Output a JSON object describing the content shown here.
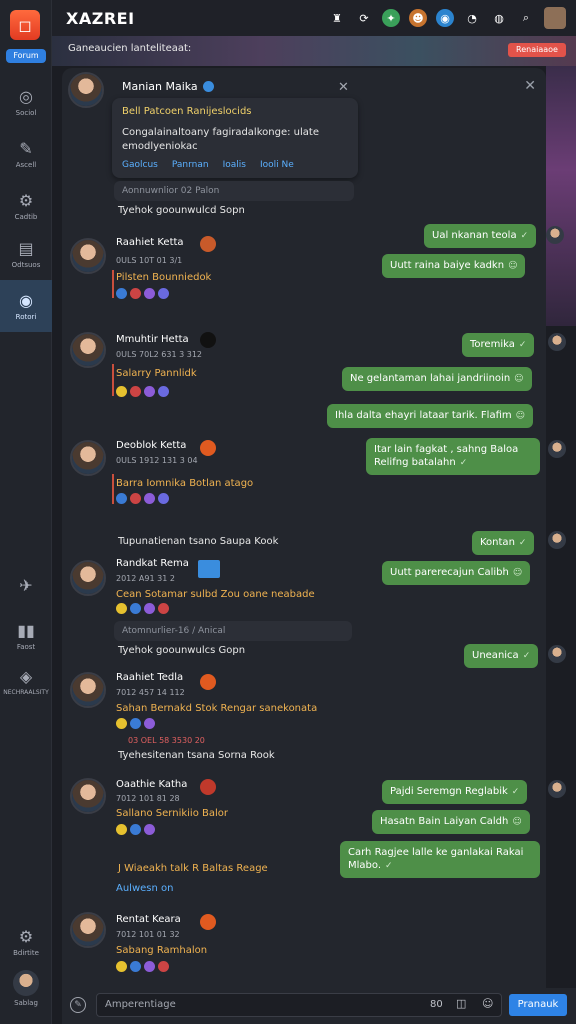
{
  "app": {
    "brand": "XAZREI",
    "logo_pill": "Forum",
    "banner_text": "Ganeaucien lanteliteaat:",
    "banner_button": "Renaiaaoe"
  },
  "rail": {
    "items": [
      {
        "label": "Sociol",
        "icon": "◎"
      },
      {
        "label": "Ascell",
        "icon": "✎"
      },
      {
        "label": "Cadtib",
        "icon": "⚙"
      },
      {
        "label": "Odtsuos",
        "icon": "▤"
      },
      {
        "label": "Rotori",
        "icon": "◉"
      }
    ],
    "bottom_items": [
      {
        "label": "",
        "icon": "✈"
      },
      {
        "label": "Faost",
        "icon": "▮▮"
      },
      {
        "label": "NECHRAALSITY",
        "icon": "◈"
      },
      {
        "label": "Bdirtite",
        "icon": "⚙"
      },
      {
        "label": "Sablag",
        "icon": ""
      }
    ]
  },
  "header": {
    "name": "Manian Maika",
    "popup_line1": "Bell Patcoen Ranijeslocids",
    "popup_line2": "Congalainaltoany fagiradalkonge: ulate emodlyeniokac",
    "popup_links": [
      "Gaolcus",
      "Panrnan",
      "Ioalis",
      "Iooli Ne"
    ]
  },
  "search1": "Aonnuwnlior 02 Palon",
  "search2": "Atomnurlier-16 / Anical",
  "system": [
    "Tyehok goounwulcd Sopn",
    "Tupunatienan tsano Saupa Kook",
    "Tyehok goounwulcs Gopn",
    "Tyehesitenan tsana Sorna Rook",
    "J Wiaeakh talk R Baltas Reage",
    "Aulwesn on"
  ],
  "messages": [
    {
      "name": "Raahiet Ketta",
      "meta": "0ULS  10T 01 3/1",
      "text": "Pilsten Bounniedok"
    },
    {
      "name": "Mmuhtir Hetta",
      "meta": "0ULS  70L2  631 3 312",
      "text": "Salarry Pannlidk"
    },
    {
      "name": "Deoblok Ketta",
      "meta": "0ULS  1912 131 3 04",
      "text": "Barra Iomnika Botlan atago"
    },
    {
      "name": "Randkat Rema",
      "meta": "2012  A91 31 2",
      "text": "Cean Sotamar sulbd Zou  oane  neabade"
    },
    {
      "name": "Raahiet Tedla",
      "meta": "7012  457 14 112",
      "text": "Sahan Bernakd Stok Rengar sanekonata"
    },
    {
      "name": "Oaathie Katha",
      "meta": "7012  101 81 28",
      "text": "Sallano Sernikiio Balor"
    },
    {
      "name": "Rentat Keara",
      "meta": "7012  101 01 32",
      "text": "Sabang Ramhalon"
    }
  ],
  "sub_meta": "03 OEL 58 3530 20",
  "bubbles": [
    "Ual nkanan teola",
    "Uutt raina baiye kadkn",
    "Toremika",
    "Ne gelantaman lahai jandriinoin",
    "Ihla dalta ehayri lataar tarik. Flafim",
    "Itar lain fagkat , sahng Baloa Relifng batalahn",
    "Kontan",
    "Uutt parerecajun Calibh",
    "Uneanica",
    "Pajdi Seremgn Reglabik",
    "Hasatn Bain Laiyan Caldh",
    "Carh Ragjee lalle ke ganlakai Rakai Mlabo."
  ],
  "input": {
    "placeholder": "Amperentiage",
    "counter": "80",
    "send": "Pranauk"
  },
  "colors": {
    "bubble": "#4e8f48",
    "accent": "#2e83e6",
    "name_text": "#f0b351"
  }
}
